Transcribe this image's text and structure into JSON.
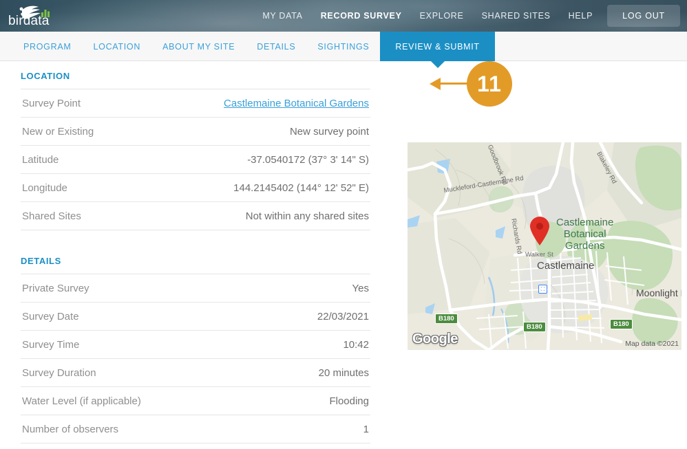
{
  "header": {
    "brand": "birdata",
    "brand_icon": "bird-swoosh-chart-logo",
    "nav": [
      {
        "label": "MY DATA",
        "active": false
      },
      {
        "label": "RECORD SURVEY",
        "active": true
      },
      {
        "label": "EXPLORE",
        "active": false
      },
      {
        "label": "SHARED SITES",
        "active": false
      },
      {
        "label": "HELP",
        "active": false
      }
    ],
    "logout_label": "LOG OUT"
  },
  "tabbar": {
    "tabs": [
      {
        "label": "PROGRAM",
        "active": false
      },
      {
        "label": "LOCATION",
        "active": false
      },
      {
        "label": "ABOUT MY SITE",
        "active": false
      },
      {
        "label": "DETAILS",
        "active": false
      },
      {
        "label": "SIGHTINGS",
        "active": false
      },
      {
        "label": "REVIEW & SUBMIT",
        "active": true
      }
    ]
  },
  "callout": {
    "number": "11"
  },
  "sections": [
    {
      "title": "LOCATION",
      "rows": [
        {
          "label": "Survey Point",
          "value": "Castlemaine Botanical Gardens",
          "link": true
        },
        {
          "label": "New or Existing",
          "value": "New survey point",
          "link": false
        },
        {
          "label": "Latitude",
          "value": "-37.0540172 (37° 3' 14\" S)",
          "link": false
        },
        {
          "label": "Longitude",
          "value": "144.2145402 (144° 12' 52\" E)",
          "link": false
        },
        {
          "label": "Shared Sites",
          "value": "Not within any shared sites",
          "link": false
        }
      ]
    },
    {
      "title": "DETAILS",
      "rows": [
        {
          "label": "Private Survey",
          "value": "Yes",
          "link": false
        },
        {
          "label": "Survey Date",
          "value": "22/03/2021",
          "link": false
        },
        {
          "label": "Survey Time",
          "value": "10:42",
          "link": false
        },
        {
          "label": "Survey Duration",
          "value": "20 minutes",
          "link": false
        },
        {
          "label": "Water Level (if applicable)",
          "value": "Flooding",
          "link": false
        },
        {
          "label": "Number of observers",
          "value": "1",
          "link": false
        }
      ]
    }
  ],
  "map": {
    "provider": "Google",
    "attribution": "Map data ©2021",
    "pin_label": "Castlemaine Botanical Gardens",
    "park_label_lines": [
      "Castlemaine",
      "Botanical",
      "Gardens"
    ],
    "town_label": "Castlemaine",
    "roads": [
      "Muckleford-Castlemaine Rd",
      "Richards Rd",
      "Walker St",
      "Blakeley Rd",
      "Goodbrook Rd"
    ],
    "place_right": "Moonlight F",
    "shields": [
      "B180",
      "B180",
      "B180"
    ]
  },
  "colors": {
    "accent_blue": "#1b8fc4",
    "link_blue": "#3aa0da",
    "callout_orange": "#e39b28",
    "pin_red": "#e02f25",
    "header_dark": "#3c5a68"
  }
}
